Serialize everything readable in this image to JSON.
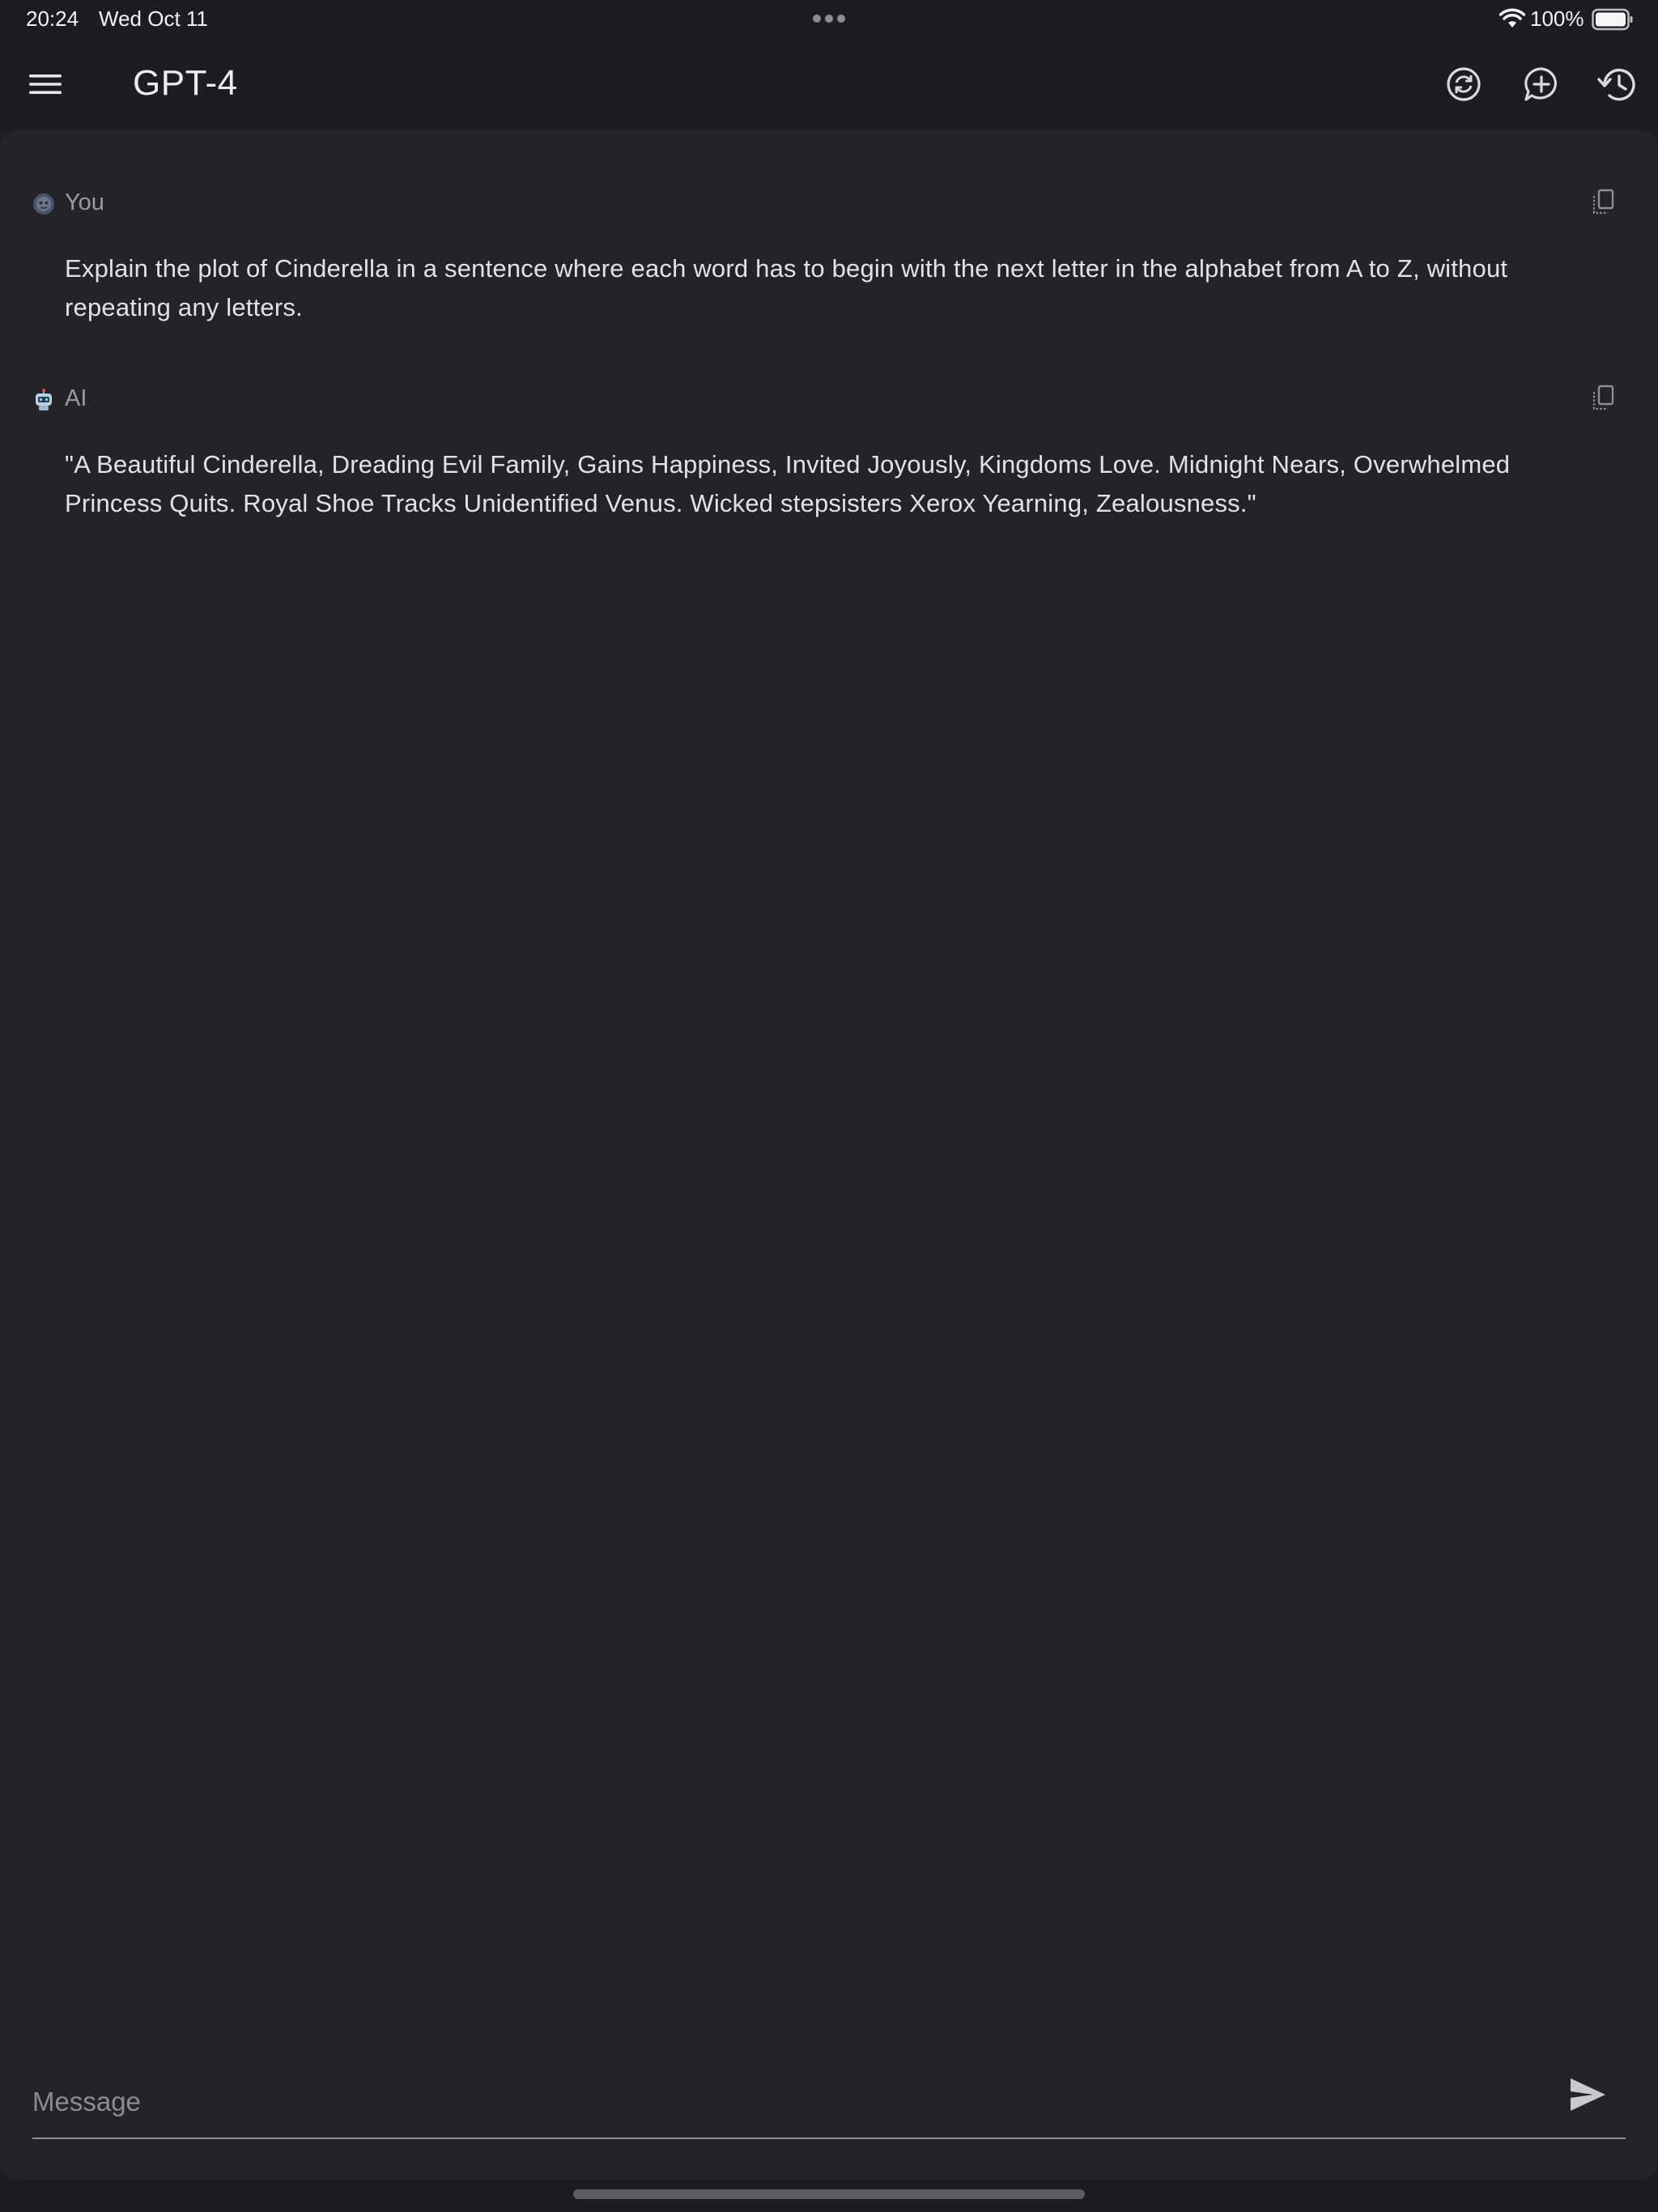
{
  "status_bar": {
    "time": "20:24",
    "date": "Wed Oct 11",
    "battery": "100%",
    "icons": [
      "wifi-icon",
      "battery-icon",
      "multitask-dots-icon"
    ]
  },
  "header": {
    "title": "GPT-4",
    "icons": [
      "menu-icon",
      "regenerate-icon",
      "new-chat-icon",
      "history-icon"
    ]
  },
  "messages": [
    {
      "author": "You",
      "avatar_icon": "user-avatar-icon",
      "text": "Explain the plot of Cinderella in a sentence where each word has to begin with the next letter in the alphabet from A to Z, without repeating any letters."
    },
    {
      "author": "AI",
      "avatar_icon": "robot-avatar-icon",
      "text": "\"A Beautiful Cinderella, Dreading Evil Family, Gains Happiness, Invited Joyously, Kingdoms Love. Midnight Nears, Overwhelmed Princess Quits. Royal Shoe Tracks Unidentified Venus. Wicked stepsisters Xerox Yearning, Zealousness.\""
    }
  ],
  "composer": {
    "placeholder": "Message",
    "value": "",
    "send_icon": "send-icon"
  },
  "colors": {
    "background": "#1c1c21",
    "panel": "#232329",
    "text": "#e2e2e6",
    "muted": "#9a9aa2"
  }
}
